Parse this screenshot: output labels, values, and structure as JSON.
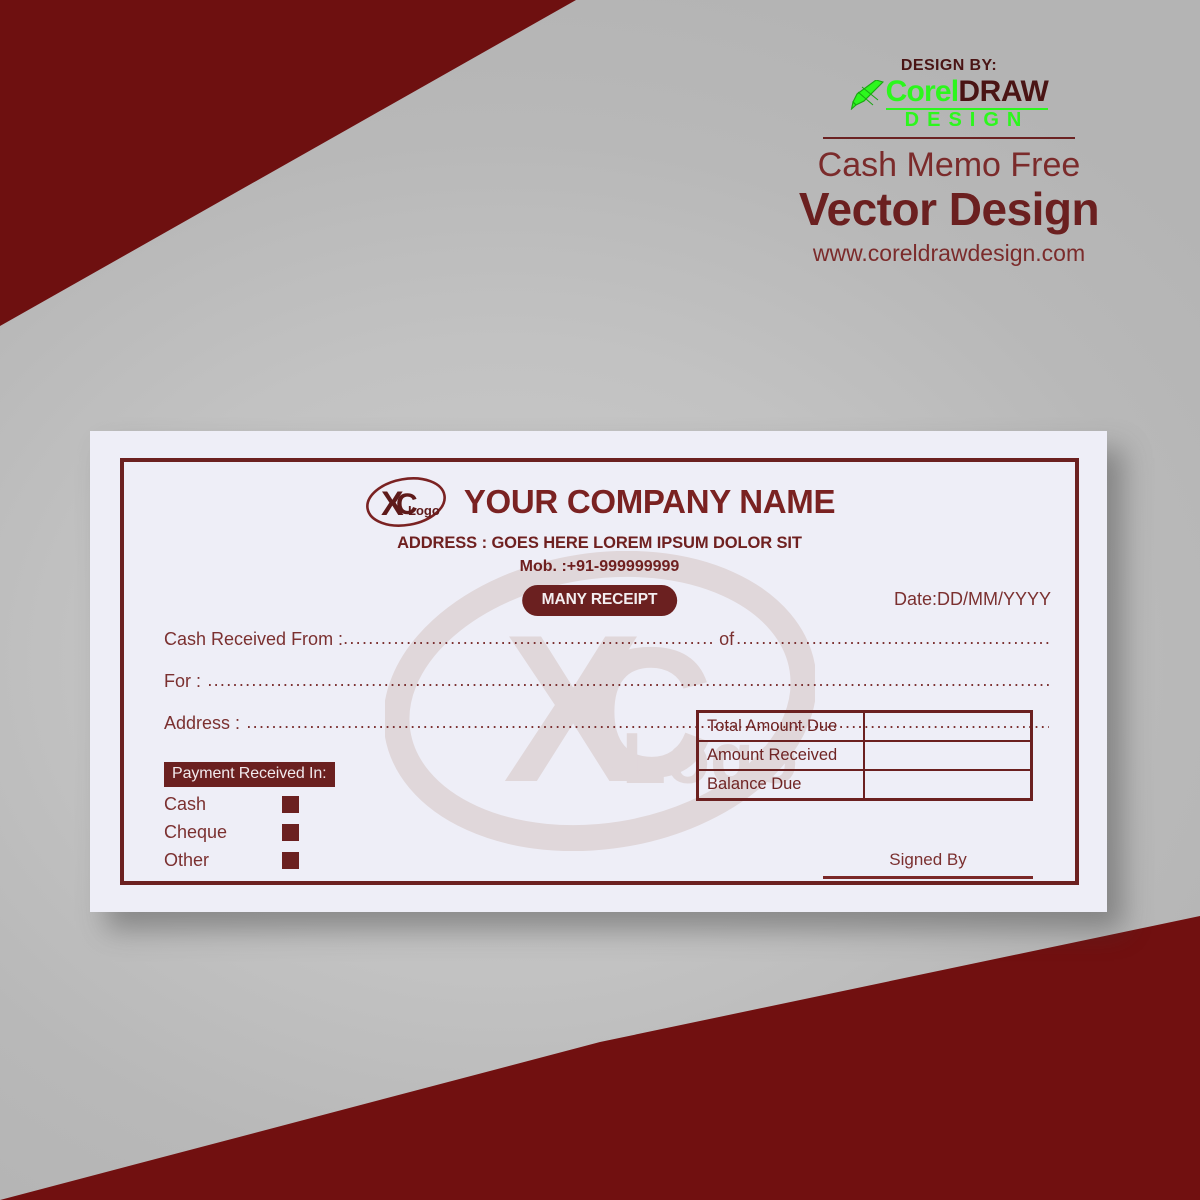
{
  "branding": {
    "design_by": "DESIGN BY:",
    "corel": "Corel",
    "draw": "DRAW",
    "design_word": "DESIGN",
    "subtitle": "Cash Memo Free",
    "title": "Vector Design",
    "url": "www.coreldrawdesign.com",
    "accent_green": "#2cf71d",
    "accent_maroon": "#6b2020"
  },
  "receipt": {
    "logo_mark": "XC",
    "logo_word": "Logo",
    "company_name": "YOUR COMPANY NAME",
    "address": "ADDRESS : GOES HERE LOREM IPSUM DOLOR SIT",
    "mobile": "Mob. :+91-999999999",
    "badge": "MANY RECEIPT",
    "date": "Date:DD/MM/YYYY",
    "fields": [
      {
        "label": "Cash Received From :",
        "connector": "of"
      },
      {
        "label": "For :",
        "connector": ""
      },
      {
        "label": "Address :",
        "connector": ""
      }
    ],
    "payment": {
      "title": "Payment Received In:",
      "options": [
        "Cash",
        "Cheque",
        "Other"
      ]
    },
    "amounts": {
      "rows": [
        {
          "label": "Total Amount Due",
          "value": ""
        },
        {
          "label": "Amount Received",
          "value": ""
        },
        {
          "label": "Balance Due",
          "value": ""
        }
      ]
    },
    "signed_by": "Signed By",
    "card_bg": "#eeeef7",
    "border_color": "#6b2020"
  },
  "background": {
    "gray": "#c2c2c2",
    "maroon": "#6e1010"
  }
}
